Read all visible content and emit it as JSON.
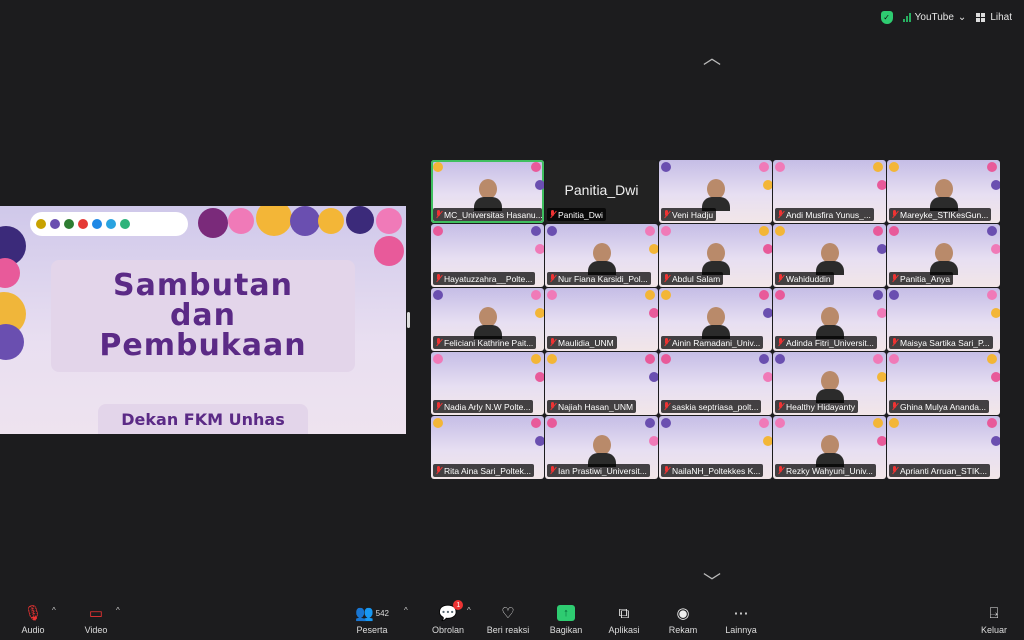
{
  "topbar": {
    "stream_label": "YouTube",
    "view_label": "Lihat"
  },
  "slide": {
    "title_line1": "Sambutan",
    "title_line2": "dan",
    "title_line3": "Pembukaan",
    "subtitle": "Dekan FKM Unhas"
  },
  "gallery": {
    "participants": [
      {
        "name": "MC_Universitas Hasanu..."
      },
      {
        "name": "Panitia_Dwi"
      },
      {
        "name": "Veni Hadju"
      },
      {
        "name": "Andi Musfira Yunus_..."
      },
      {
        "name": "Mareyke_STIKesGun..."
      },
      {
        "name": "Hayatuzzahra__Polte..."
      },
      {
        "name": "Nur Fiana Karsidi_Pol..."
      },
      {
        "name": "Abdul Salam"
      },
      {
        "name": "Wahiduddin"
      },
      {
        "name": "Panitia_Anya"
      },
      {
        "name": "Feliciani Kathrine Pait..."
      },
      {
        "name": "Maulidia_UNM"
      },
      {
        "name": "Ainin Ramadani_Univ..."
      },
      {
        "name": "Adinda Fitri_Universit..."
      },
      {
        "name": "Maisya Sartika Sari_P..."
      },
      {
        "name": "Nadia Arly N.W Polte..."
      },
      {
        "name": "Najiah Hasan_UNM"
      },
      {
        "name": "saskia septriasa_polt..."
      },
      {
        "name": "Healthy Hidayanty"
      },
      {
        "name": "Ghina Mulya Ananda..."
      },
      {
        "name": "Rita Aina Sari_Poltek..."
      },
      {
        "name": "Ian Prastiwi_Universit..."
      },
      {
        "name": "NailaNH_Poltekkes K..."
      },
      {
        "name": "Rezky Wahyuni_Univ..."
      },
      {
        "name": "Aprianti Arruan_STIK..."
      }
    ],
    "big_name": "Panitia_Dwi"
  },
  "toolbar": {
    "audio": "Audio",
    "video": "Video",
    "participants": "Peserta",
    "participant_count": "542",
    "chat": "Obrolan",
    "chat_badge": "1",
    "reactions": "Beri reaksi",
    "share": "Bagikan",
    "apps": "Aplikasi",
    "record": "Rekam",
    "more": "Lainnya",
    "leave": "Keluar"
  },
  "colors": {
    "accent_green": "#2ecc71",
    "slide_purple": "#5b2a86",
    "mute_red": "#e33333"
  }
}
